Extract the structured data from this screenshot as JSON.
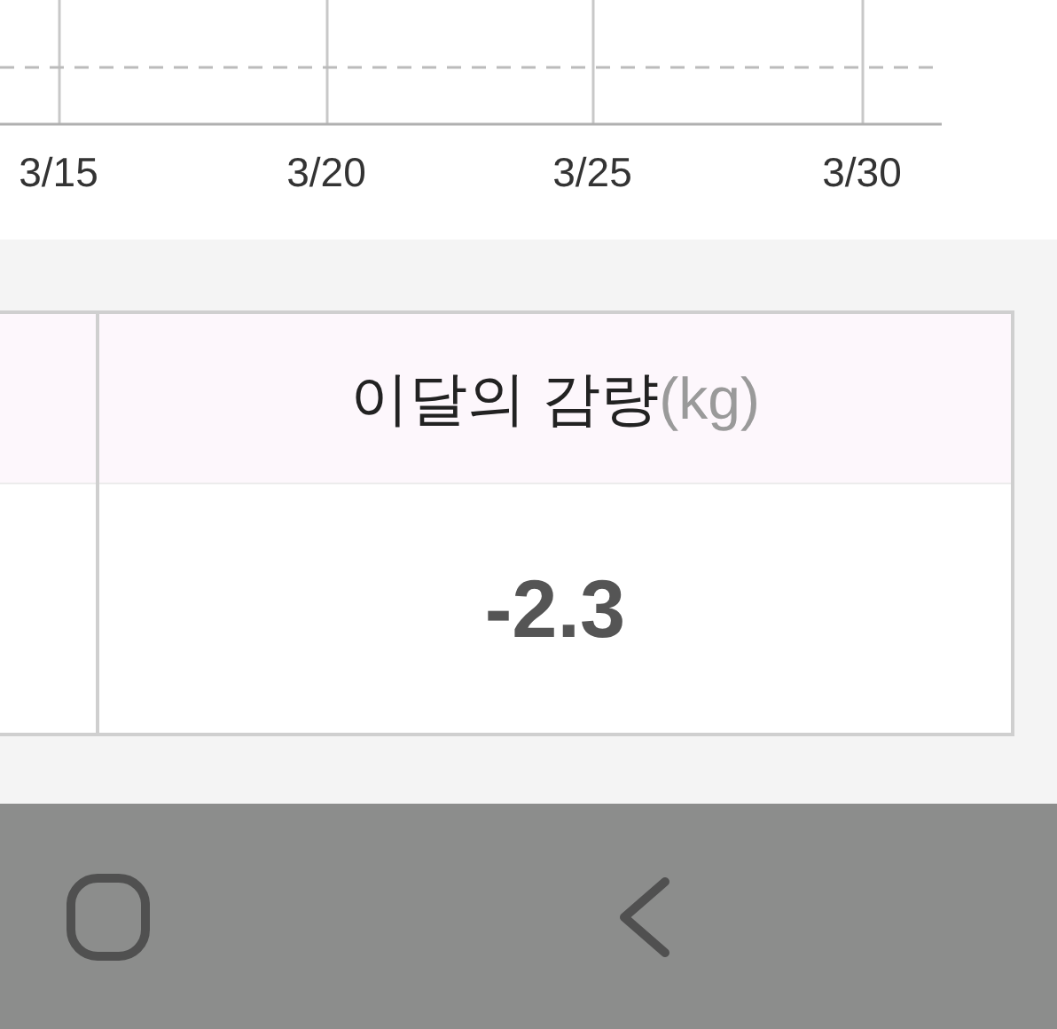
{
  "chart": {
    "x_labels": [
      "3/15",
      "3/20",
      "3/25",
      "3/30"
    ]
  },
  "summary_table": {
    "header": {
      "label": "이달의 감량",
      "unit": "(kg)"
    },
    "value": "-2.3"
  }
}
